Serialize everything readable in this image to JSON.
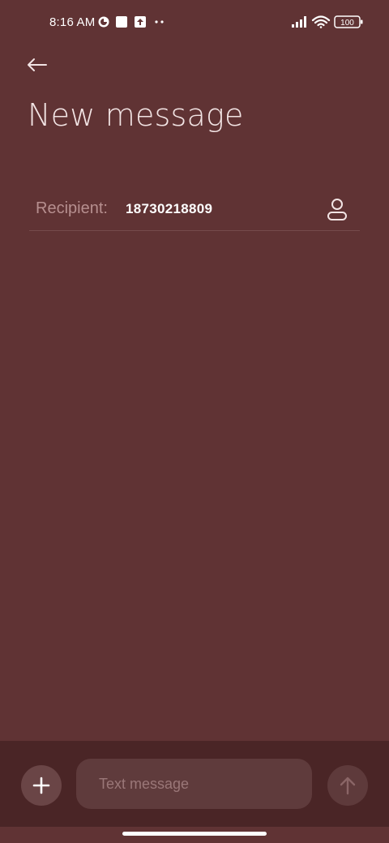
{
  "status_bar": {
    "time": "8:16 AM",
    "battery": "100",
    "left_icons": [
      "data-saver-icon",
      "square-notification-icon",
      "upload-notification-icon",
      "more-dots-icon"
    ],
    "right_icons": [
      "signal-icon",
      "wifi-icon",
      "battery-icon"
    ]
  },
  "header": {
    "back_icon": "arrow-left-icon",
    "title": "New message"
  },
  "recipient": {
    "label": "Recipient:",
    "value": "18730218809",
    "contact_icon": "person-icon"
  },
  "compose": {
    "attach_icon": "plus-icon",
    "placeholder": "Text message",
    "send_icon": "arrow-up-icon"
  },
  "colors": {
    "background": "#603334",
    "compose_bar": "#4a2526",
    "input": "#5f3b3c"
  }
}
